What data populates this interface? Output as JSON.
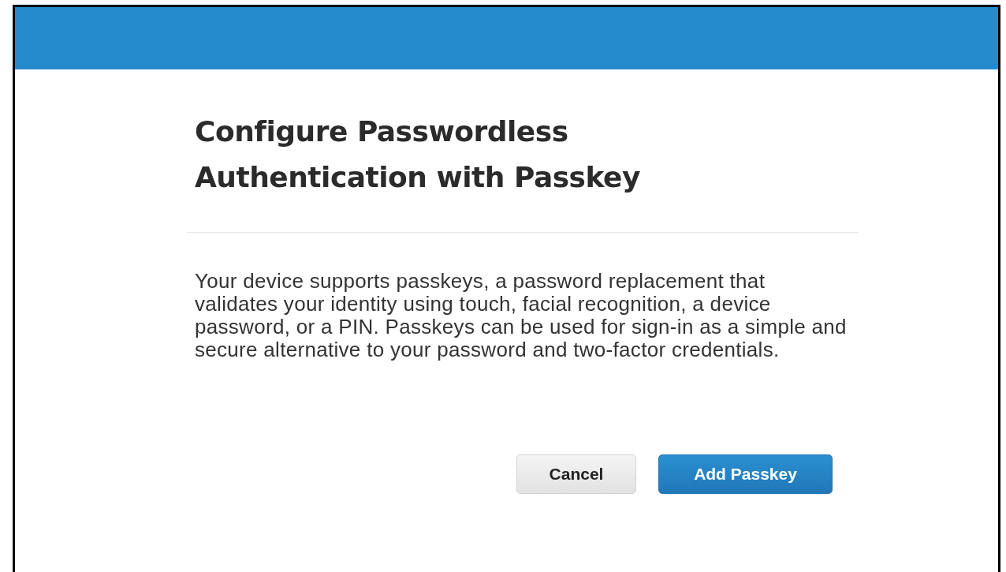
{
  "dialog": {
    "title": "Configure Passwordless Authentication with Passkey",
    "message": "Your device supports passkeys, a password replacement that validates your identity using touch, facial recognition, a device password, or a PIN. Passkeys can be used for sign-in as a simple and secure alternative to your password and two-factor credentials.",
    "buttons": [
      {
        "label": "Cancel",
        "kind": "secondary"
      },
      {
        "label": "Add Passkey",
        "kind": "primary"
      }
    ]
  }
}
